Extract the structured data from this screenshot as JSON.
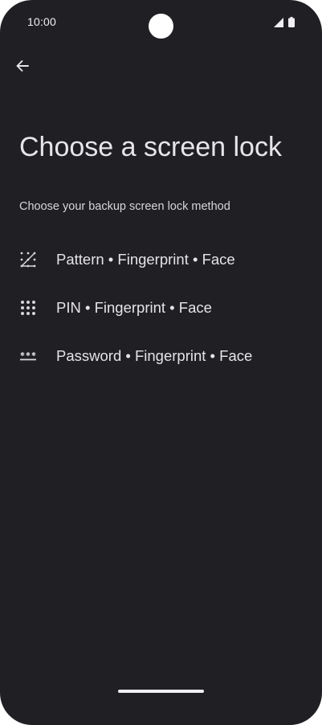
{
  "status_bar": {
    "time": "10:00",
    "icons": [
      "signal-icon",
      "battery-icon"
    ]
  },
  "header": {
    "back_icon": "arrow-back-icon"
  },
  "page": {
    "title": "Choose a screen lock",
    "subtitle": "Choose your backup screen lock method"
  },
  "options": [
    {
      "icon": "pattern-icon",
      "label": "Pattern • Fingerprint • Face"
    },
    {
      "icon": "pin-icon",
      "label": "PIN • Fingerprint • Face"
    },
    {
      "icon": "password-icon",
      "label": "Password • Fingerprint • Face"
    }
  ],
  "colors": {
    "background": "#202024",
    "text_primary": "#e6e3e8",
    "text_secondary": "#d8d5db"
  }
}
